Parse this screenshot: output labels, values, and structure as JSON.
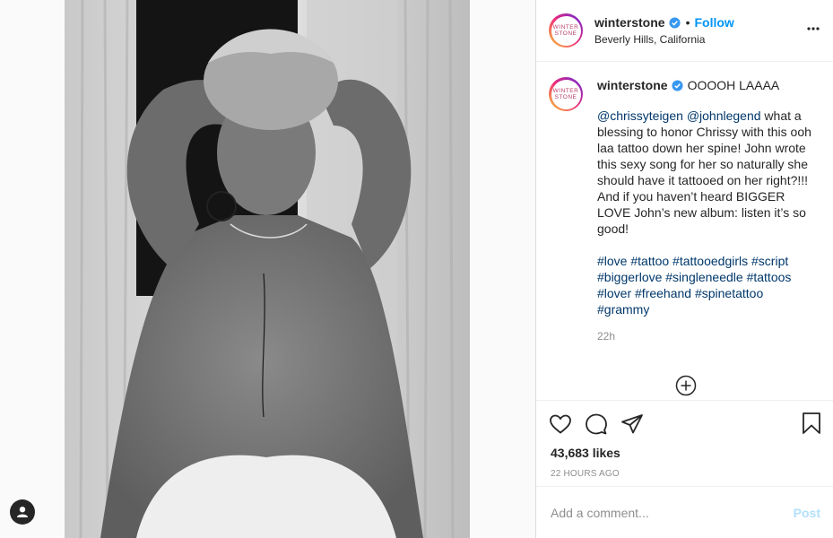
{
  "post": {
    "username": "winterstone",
    "follow_label": "Follow",
    "location": "Beverly Hills, California",
    "avatar_text_top": "WINTER",
    "avatar_text_bottom": "STONE"
  },
  "caption": {
    "title": "OOOOH LAAAA",
    "mention_1": "@chrissyteigen",
    "mention_2": "@johnlegend",
    "body": " what a blessing to honor Chrissy with this ooh laa tattoo down her spine! John wrote this sexy song for her so naturally she should have it tattooed on her right?!!! And if you haven’t heard BIGGER LOVE John’s new album: listen it’s so good!",
    "hashtags": "#love #tattoo #tattooedgirls #script #biggerlove #singleneedle #tattoos #lover #freehand #spinetattoo #grammy",
    "time": "22h"
  },
  "stats": {
    "likes": "43,683 likes",
    "ago": "22 HOURS AGO"
  },
  "comment": {
    "placeholder": "Add a comment...",
    "post_label": "Post"
  },
  "colors": {
    "accent": "#0095f6",
    "verified": "#3897f0",
    "post_disabled": "#b2dffc"
  }
}
